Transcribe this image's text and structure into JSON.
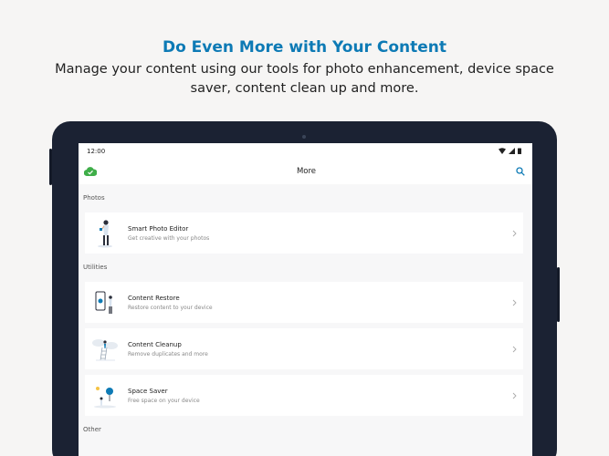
{
  "promo": {
    "title": "Do Even More with Your Content",
    "subtitle": "Manage your content using our tools for photo enhancement, device space saver, content clean up and more."
  },
  "status_bar": {
    "time": "12:00",
    "icons": [
      "wifi-icon",
      "signal-icon",
      "battery-icon"
    ]
  },
  "app_bar": {
    "title": "More",
    "logo_icon": "cloud-check-icon",
    "action_icon": "search-icon"
  },
  "sections": [
    {
      "label": "Photos",
      "items": [
        {
          "title": "Smart Photo Editor",
          "subtitle": "Get creative with your photos",
          "illustration": "person-illustration"
        }
      ]
    },
    {
      "label": "Utilities",
      "items": [
        {
          "title": "Content Restore",
          "subtitle": "Restore content to your device",
          "illustration": "phone-person-illustration"
        },
        {
          "title": "Content Cleanup",
          "subtitle": "Remove duplicates and more",
          "illustration": "clouds-ladder-illustration"
        },
        {
          "title": "Space Saver",
          "subtitle": "Free space on your device",
          "illustration": "balloon-illustration"
        }
      ]
    },
    {
      "label": "Other",
      "items": []
    }
  ],
  "colors": {
    "brand": "#0d7ab5",
    "accent_green": "#3fae49",
    "tablet_frame": "#1b2233"
  }
}
